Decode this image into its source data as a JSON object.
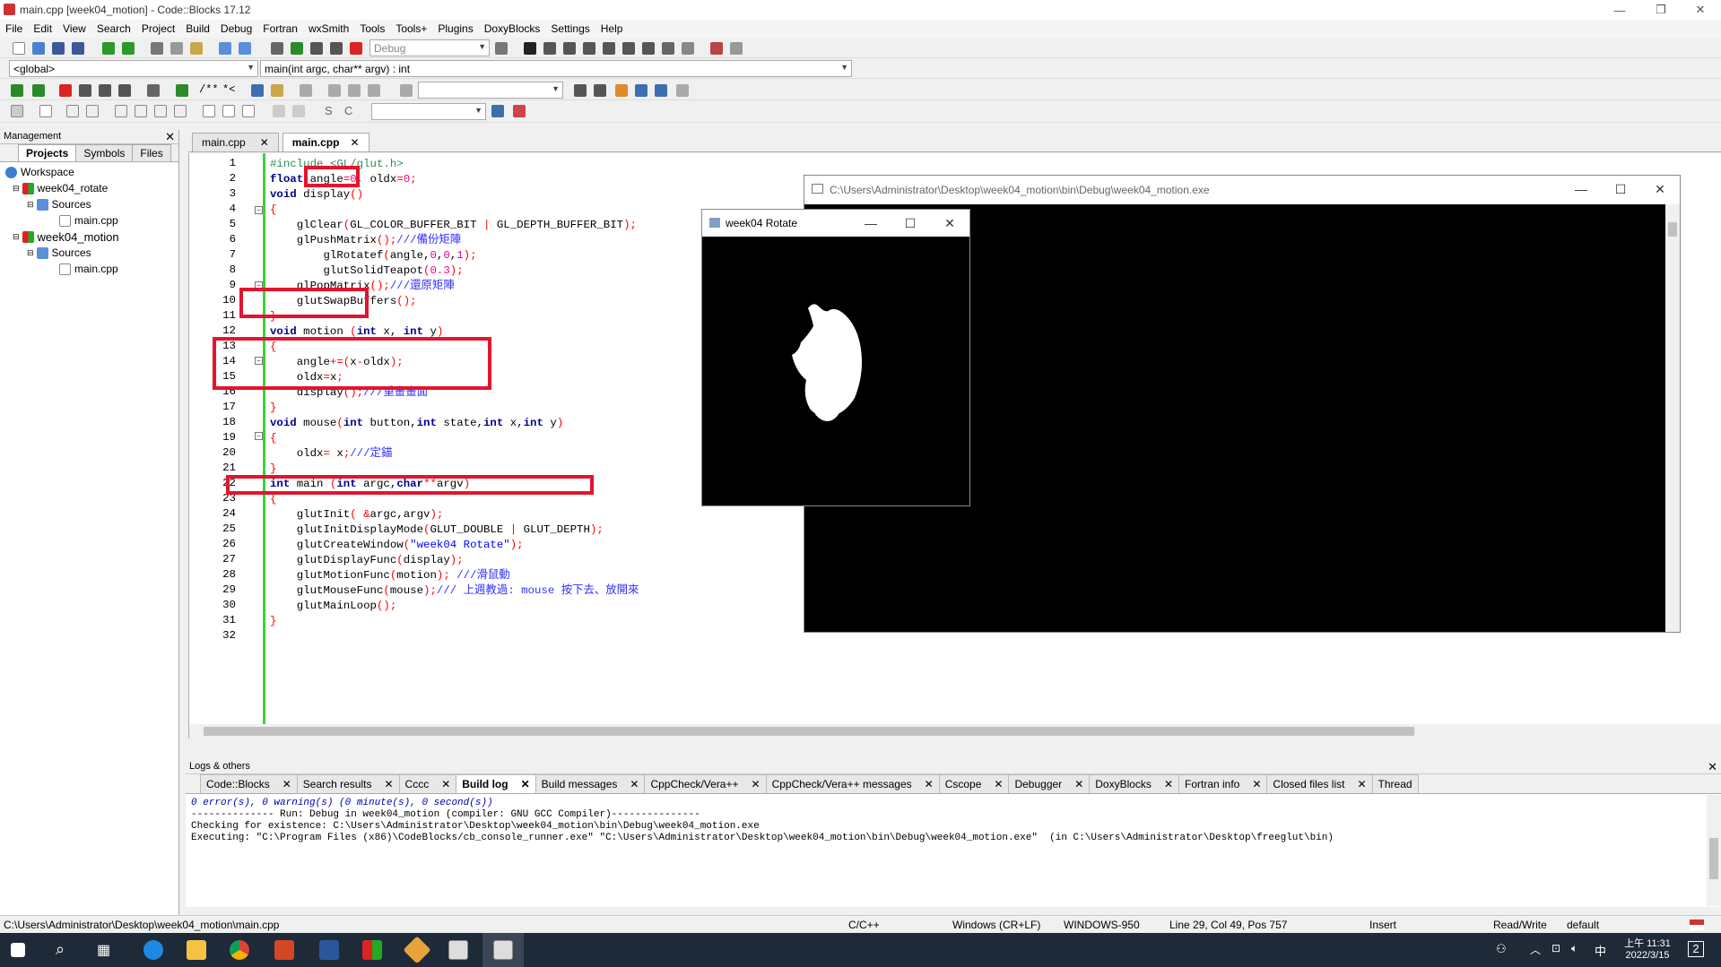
{
  "window": {
    "title": "main.cpp [week04_motion] - Code::Blocks 17.12"
  },
  "menu": [
    "File",
    "Edit",
    "View",
    "Search",
    "Project",
    "Build",
    "Debug",
    "Fortran",
    "wxSmith",
    "Tools",
    "Tools+",
    "Plugins",
    "DoxyBlocks",
    "Settings",
    "Help"
  ],
  "toolbar": {
    "build_target": "Debug",
    "scope": "<global>",
    "function": "main(int argc, char** argv) : int"
  },
  "management": {
    "header": "Management",
    "tabs": [
      "Projects",
      "Symbols",
      "Files"
    ],
    "tree": [
      {
        "label": "Workspace",
        "level": 0
      },
      {
        "label": "week04_rotate",
        "level": 1
      },
      {
        "label": "Sources",
        "level": 2
      },
      {
        "label": "main.cpp",
        "level": 3
      },
      {
        "label": "week04_motion",
        "level": 1
      },
      {
        "label": "Sources",
        "level": 2
      },
      {
        "label": "main.cpp",
        "level": 3
      }
    ]
  },
  "editor": {
    "tabs": [
      "main.cpp",
      "main.cpp"
    ],
    "line_count": 32
  },
  "console_window": {
    "title": "C:\\Users\\Administrator\\Desktop\\week04_motion\\bin\\Debug\\week04_motion.exe"
  },
  "rotate_window": {
    "title": "week04 Rotate"
  },
  "logs": {
    "header": "Logs & others",
    "tabs": [
      "Code::Blocks",
      "Search results",
      "Cccc",
      "Build log",
      "Build messages",
      "CppCheck/Vera++",
      "CppCheck/Vera++ messages",
      "Cscope",
      "Debugger",
      "DoxyBlocks",
      "Fortran info",
      "Closed files list",
      "Thread"
    ],
    "lines": [
      "0 error(s), 0 warning(s) (0 minute(s), 0 second(s))",
      "",
      "",
      "-------------- Run: Debug in week04_motion (compiler: GNU GCC Compiler)---------------",
      "",
      "Checking for existence: C:\\Users\\Administrator\\Desktop\\week04_motion\\bin\\Debug\\week04_motion.exe",
      "Executing: \"C:\\Program Files (x86)\\CodeBlocks/cb_console_runner.exe\" \"C:\\Users\\Administrator\\Desktop\\week04_motion\\bin\\Debug\\week04_motion.exe\"  (in C:\\Users\\Administrator\\Desktop\\freeglut\\bin)"
    ]
  },
  "status": {
    "path": "C:\\Users\\Administrator\\Desktop\\week04_motion\\main.cpp",
    "lang": "C/C++",
    "eol": "Windows (CR+LF)",
    "encoding": "WINDOWS-950",
    "position": "Line 29, Col 49, Pos 757",
    "mode": "Insert",
    "rw": "Read/Write",
    "profile": "default"
  },
  "taskbar": {
    "time": "上午 11:31",
    "date": "2022/3/15",
    "ime": "中",
    "notif": "2"
  }
}
